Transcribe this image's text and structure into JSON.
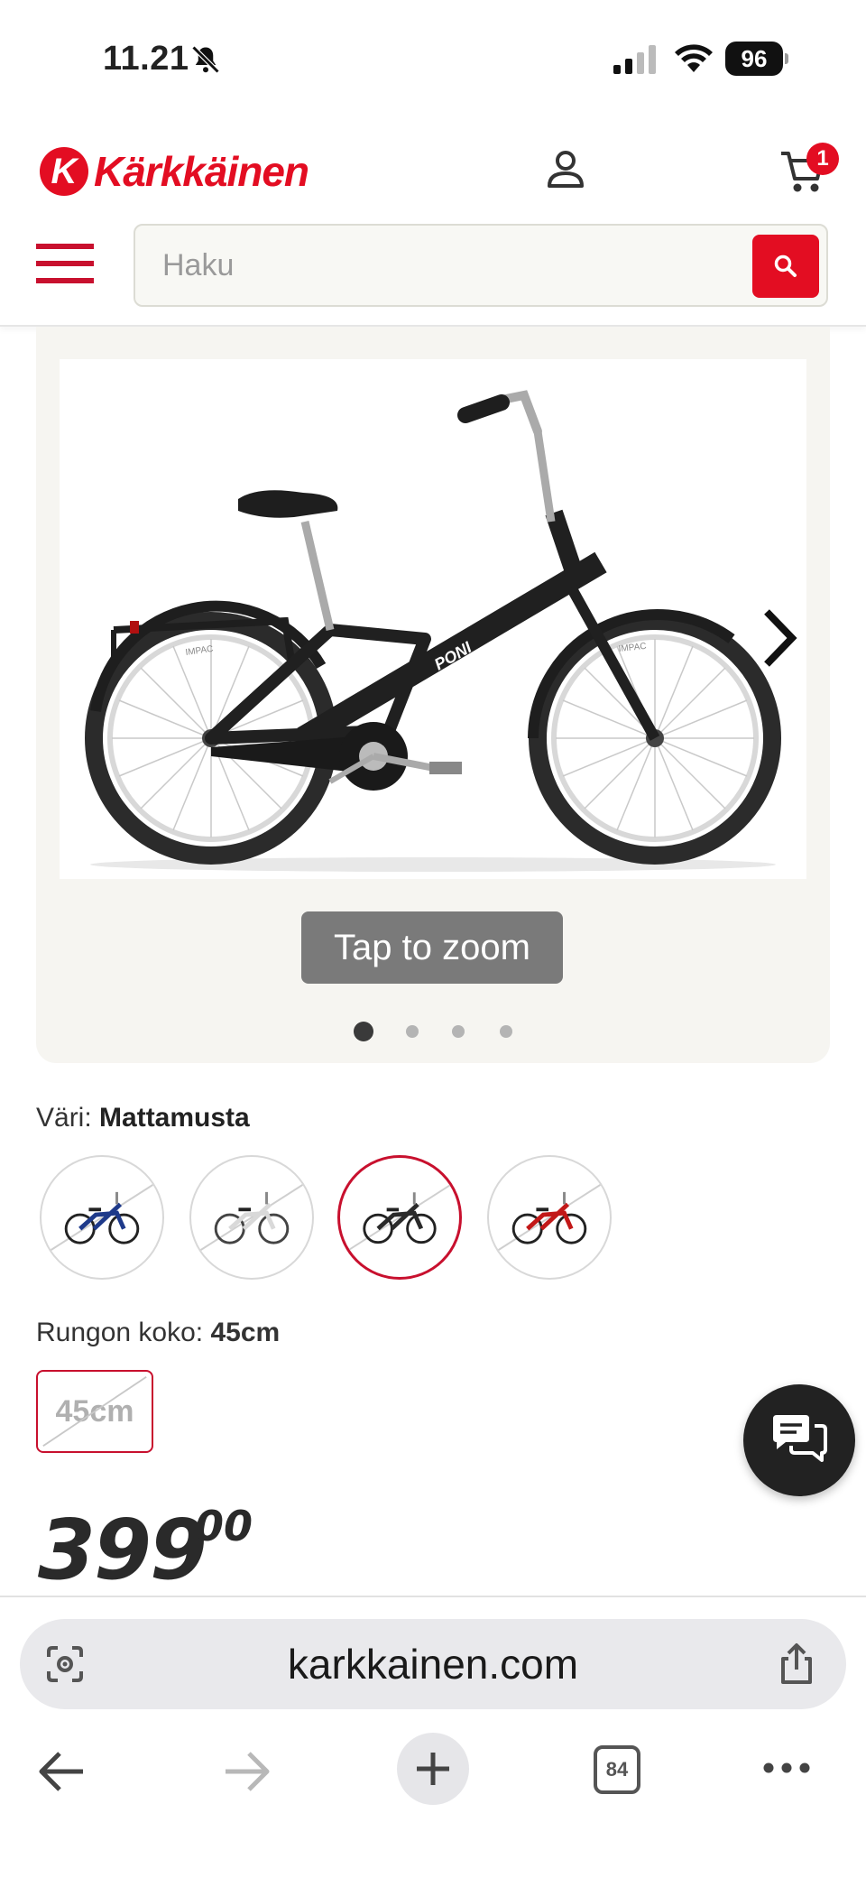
{
  "status_bar": {
    "time": "11.21",
    "battery": "96",
    "icons": [
      "bell-off-icon",
      "signal-icon",
      "wifi-icon",
      "battery-icon"
    ]
  },
  "header": {
    "logo_letter": "K",
    "logo_text": "Kärkkäinen",
    "cart_count": "1",
    "search_placeholder": "Haku",
    "icons": [
      "account-icon",
      "cart-icon",
      "menu-icon",
      "search-icon"
    ],
    "accent_color": "#e30d22"
  },
  "gallery": {
    "zoom_label": "Tap to zoom",
    "image_count": 4,
    "active_index": 0,
    "frame_brand": "PONI",
    "tire_text": "IMPAC"
  },
  "color": {
    "label": "Väri:",
    "selected": "Mattamusta",
    "options": [
      {
        "color": "#1e3a8a"
      },
      {
        "color": "#eeeeee"
      },
      {
        "color": "#2a2a2a"
      },
      {
        "color": "#c21818"
      }
    ],
    "selected_index": 2
  },
  "size": {
    "label": "Rungon koko:",
    "selected": "45cm",
    "options": [
      "45cm"
    ]
  },
  "price": {
    "main": "399",
    "cents": "00"
  },
  "browser": {
    "url": "karkkainen.com",
    "tab_count": "84",
    "icons": [
      "lens-icon",
      "share-icon",
      "back-icon",
      "forward-icon",
      "plus-icon",
      "tabs-icon",
      "more-icon"
    ]
  }
}
